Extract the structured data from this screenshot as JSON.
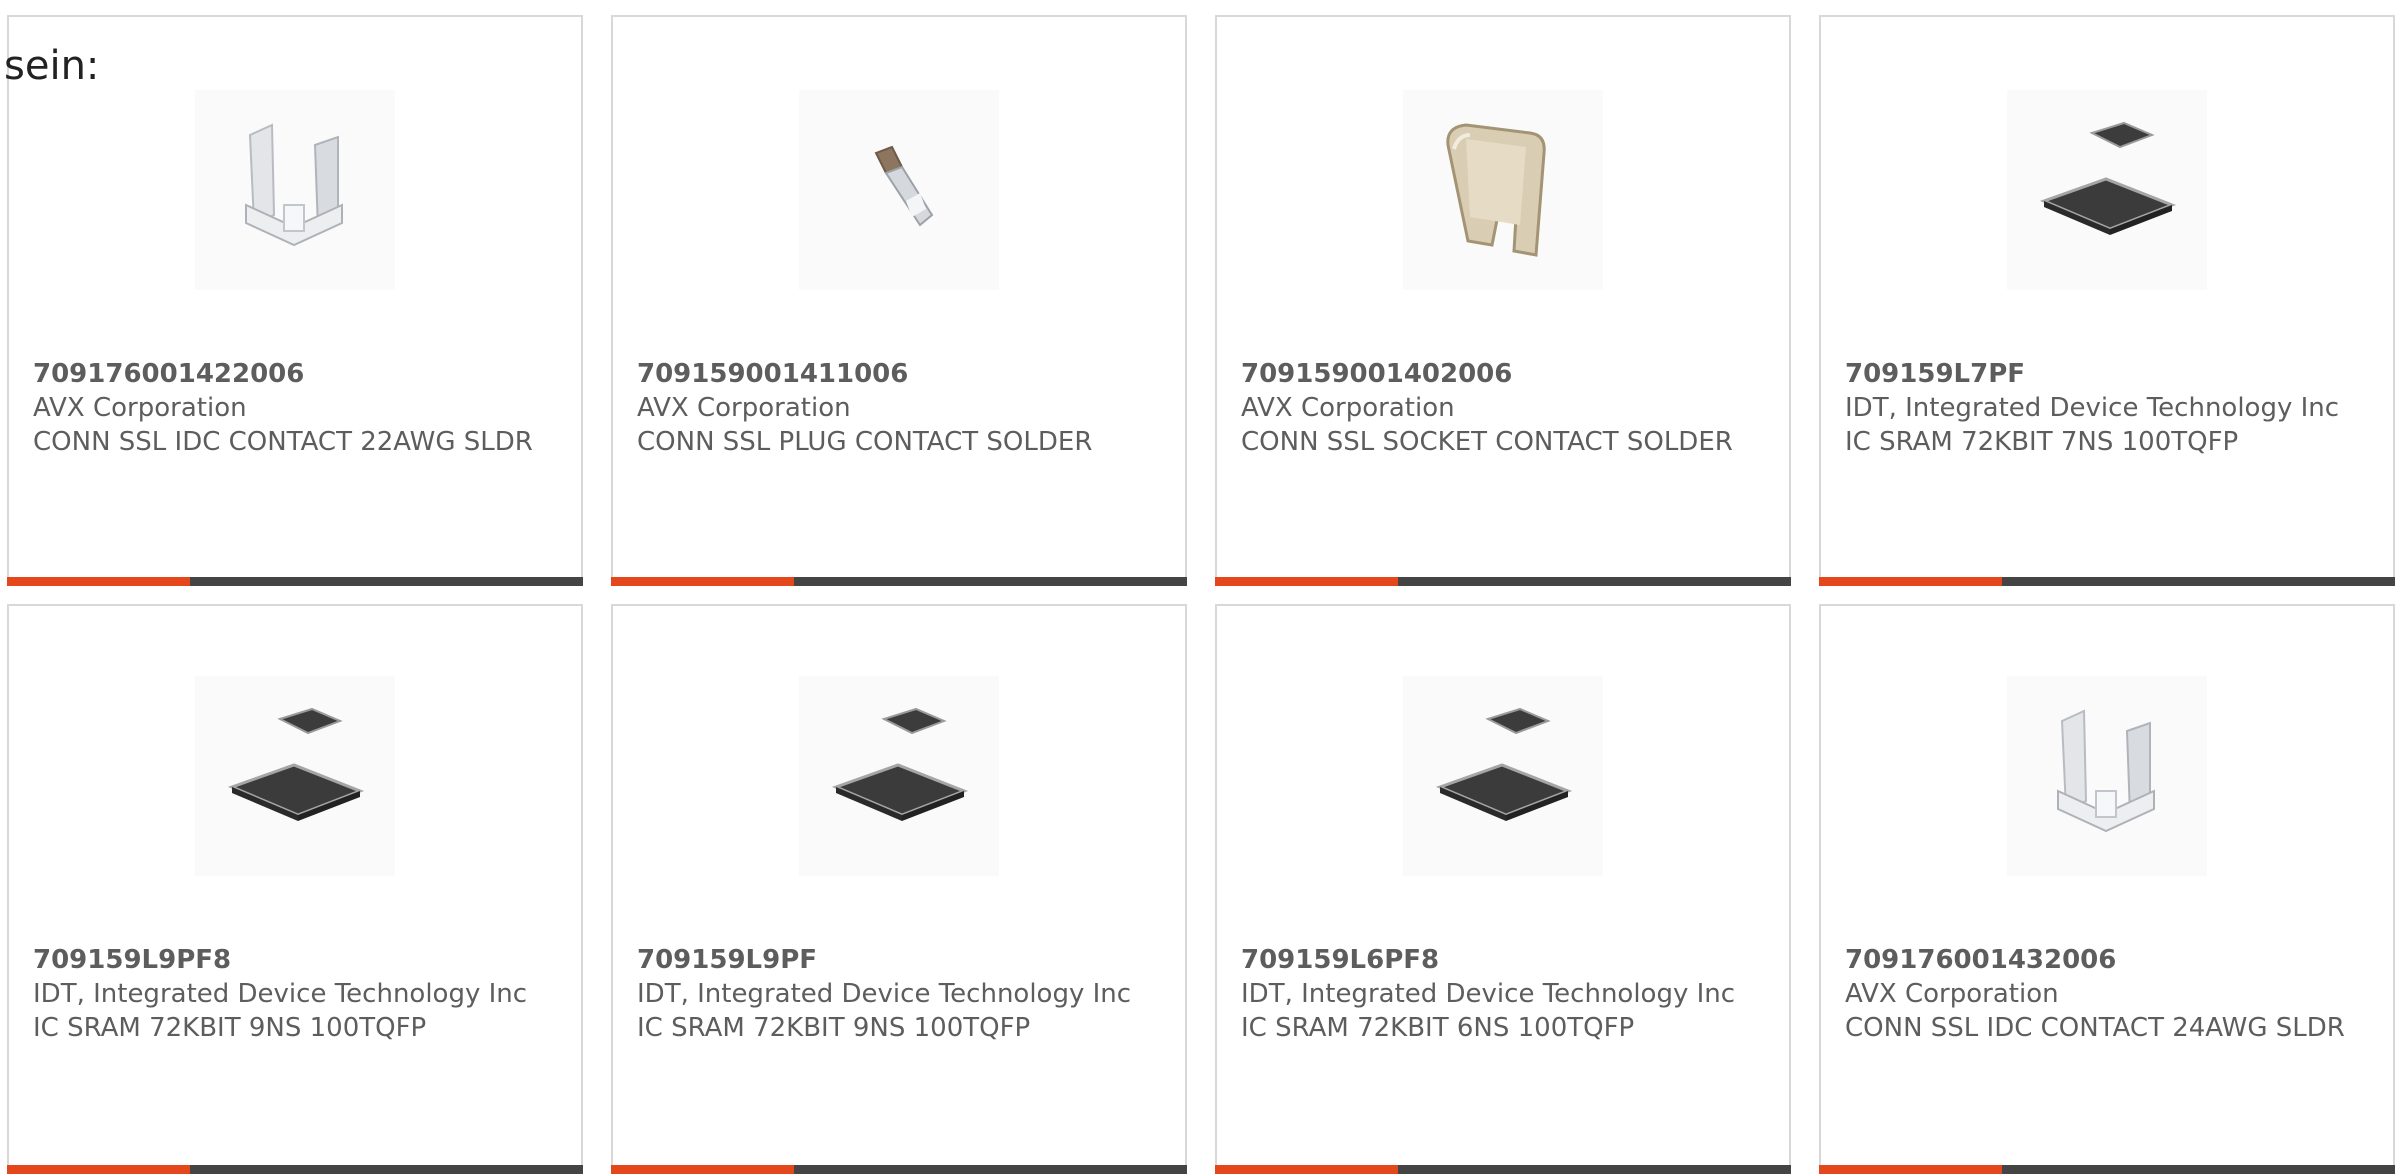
{
  "intro_text": "sein:",
  "accent_color": "#e3471b",
  "bar_color": "#444444",
  "products": [
    {
      "part": "709176001422006",
      "manufacturer": "AVX Corporation",
      "description": "CONN SSL IDC CONTACT 22AWG SLDR",
      "image": "idc-contact-image"
    },
    {
      "part": "709159001411006",
      "manufacturer": "AVX Corporation",
      "description": "CONN SSL PLUG CONTACT SOLDER",
      "image": "plug-contact-image"
    },
    {
      "part": "709159001402006",
      "manufacturer": "AVX Corporation",
      "description": "CONN SSL SOCKET CONTACT SOLDER",
      "image": "socket-contact-image"
    },
    {
      "part": "709159L7PF",
      "manufacturer": "IDT, Integrated Device Technology Inc",
      "description": "IC SRAM 72KBIT 7NS 100TQFP",
      "image": "tqfp-chip-image"
    },
    {
      "part": "709159L9PF8",
      "manufacturer": "IDT, Integrated Device Technology Inc",
      "description": "IC SRAM 72KBIT 9NS 100TQFP",
      "image": "tqfp-chip-image"
    },
    {
      "part": "709159L9PF",
      "manufacturer": "IDT, Integrated Device Technology Inc",
      "description": "IC SRAM 72KBIT 9NS 100TQFP",
      "image": "tqfp-chip-image"
    },
    {
      "part": "709159L6PF8",
      "manufacturer": "IDT, Integrated Device Technology Inc",
      "description": "IC SRAM 72KBIT 6NS 100TQFP",
      "image": "tqfp-chip-image"
    },
    {
      "part": "709176001432006",
      "manufacturer": "AVX Corporation",
      "description": "CONN SSL IDC CONTACT 24AWG SLDR",
      "image": "idc-contact-image"
    }
  ]
}
